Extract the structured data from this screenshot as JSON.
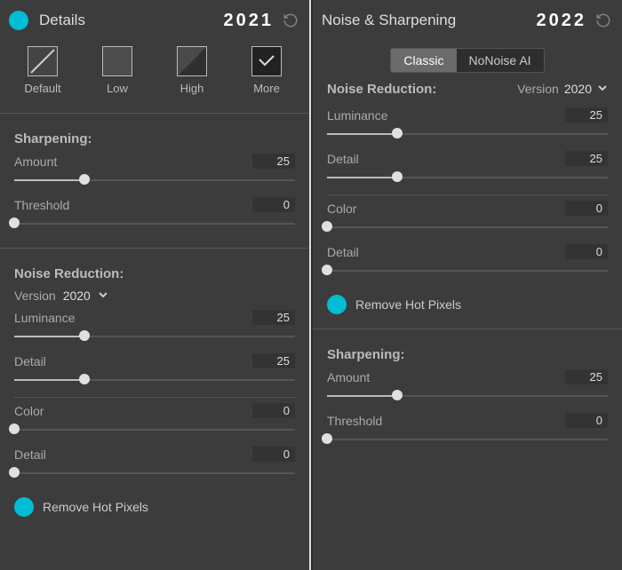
{
  "left": {
    "title": "Details",
    "year": "2021",
    "presets": {
      "default": "Default",
      "low": "Low",
      "high": "High",
      "more": "More"
    },
    "sharpening": {
      "title": "Sharpening:",
      "amount": {
        "label": "Amount",
        "value": "25",
        "pct": 25
      },
      "threshold": {
        "label": "Threshold",
        "value": "0",
        "pct": 0
      }
    },
    "noise": {
      "title": "Noise Reduction:",
      "version_label": "Version",
      "version_value": "2020",
      "luminance": {
        "label": "Luminance",
        "value": "25",
        "pct": 25
      },
      "detail": {
        "label": "Detail",
        "value": "25",
        "pct": 25
      },
      "color": {
        "label": "Color",
        "value": "0",
        "pct": 0
      },
      "detail2": {
        "label": "Detail",
        "value": "0",
        "pct": 0
      }
    },
    "hot_label": "Remove Hot Pixels"
  },
  "right": {
    "title": "Noise & Sharpening",
    "year": "2022",
    "toggle": {
      "a": "Classic",
      "b": "NoNoise AI"
    },
    "noise": {
      "title": "Noise Reduction:",
      "version_label": "Version",
      "version_value": "2020",
      "luminance": {
        "label": "Luminance",
        "value": "25",
        "pct": 25
      },
      "detail": {
        "label": "Detail",
        "value": "25",
        "pct": 25
      },
      "color": {
        "label": "Color",
        "value": "0",
        "pct": 0
      },
      "detail2": {
        "label": "Detail",
        "value": "0",
        "pct": 0
      }
    },
    "hot_label": "Remove Hot Pixels",
    "sharpening": {
      "title": "Sharpening:",
      "amount": {
        "label": "Amount",
        "value": "25",
        "pct": 25
      },
      "threshold": {
        "label": "Threshold",
        "value": "0",
        "pct": 0
      }
    }
  }
}
